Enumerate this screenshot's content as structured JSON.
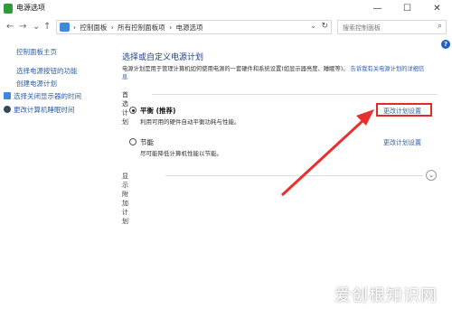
{
  "window": {
    "title": "电源选项",
    "minimize": "—",
    "maximize": "☐",
    "close": "✕"
  },
  "nav": {
    "back": "←",
    "forward": "→",
    "recent": "⌄",
    "up": "↑",
    "breadcrumbs": [
      "控制面板",
      "›",
      "所有控制面板项",
      "›",
      "电源选项"
    ],
    "separator_first": "›",
    "dropdown": "⌄",
    "refresh": "↻",
    "search_placeholder": "搜索控制面板",
    "search_icon": "⌕"
  },
  "help": "?",
  "sidebar": {
    "home": "控制面板主页",
    "items": [
      "选择电源按钮的功能",
      "创建电源计划",
      "选择关闭显示器的时间",
      "更改计算机睡眠时间"
    ]
  },
  "main": {
    "heading": "选择或自定义电源计划",
    "description": "电源计划是用于管理计算机如何使用电源的一套硬件和系统设置(如显示器亮度、睡眠等)。",
    "description_link": "告诉我有关电源计划的详细信息",
    "preferred_label": "首选计划",
    "plans": [
      {
        "name": "平衡 (推荐)",
        "desc": "利用可用的硬件自动平衡功耗与性能。",
        "link": "更改计划设置",
        "selected": true
      },
      {
        "name": "节能",
        "desc": "尽可能降低计算机性能以节能。",
        "link": "更改计划设置",
        "selected": false
      }
    ],
    "extra_label": "显示附加计划",
    "expand": "⌄"
  },
  "watermark": "爱创根知识网",
  "colors": {
    "highlight": "#e6282b",
    "arrow": "#e8302f",
    "link": "#2d5ea8",
    "heading": "#1e3c8c"
  }
}
